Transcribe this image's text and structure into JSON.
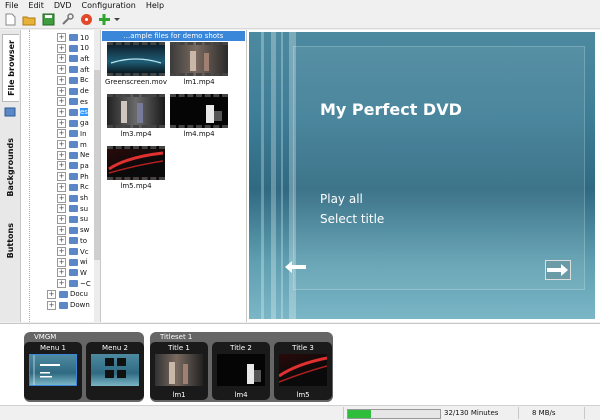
{
  "menubar": {
    "items": [
      "File",
      "Edit",
      "DVD",
      "Configuration",
      "Help"
    ]
  },
  "sidetabs": [
    "File browser",
    "Backgrounds",
    "Buttons"
  ],
  "tree": {
    "items": [
      "10",
      "10",
      "aft",
      "aft",
      "Bc",
      "de",
      "es",
      "es",
      "ga",
      "In",
      "m",
      "Ne",
      "pa",
      "Ph",
      "Rc",
      "sh",
      "su",
      "su",
      "sw",
      "to",
      "Vc",
      "wi",
      "W",
      "~C",
      "Docu",
      "Down"
    ]
  },
  "files": {
    "header": "...ample files for demo shots",
    "items": [
      "Greenscreen.mov",
      "lm1.mp4",
      "lm3.mp4",
      "lm4.mp4",
      "lm5.mp4"
    ]
  },
  "preview": {
    "title": "My Perfect DVD",
    "items": [
      "Play all",
      "Select title"
    ]
  },
  "vmgm": {
    "label": "VMGM",
    "menus": [
      "Menu 1",
      "Menu 2"
    ]
  },
  "titleset": {
    "label": "Titleset 1",
    "titles": [
      {
        "title": "Title 1",
        "file": "lm1"
      },
      {
        "title": "Title 2",
        "file": "lm4"
      },
      {
        "title": "Title 3",
        "file": "lm5"
      }
    ]
  },
  "status": {
    "duration": "32/130 Minutes",
    "rate": "8 MB/s",
    "progress_fraction": 0.25
  },
  "colors": {
    "selection": "#3a86d8",
    "progress": "#2fbd3c",
    "menu_bg": "#3d7d96"
  }
}
